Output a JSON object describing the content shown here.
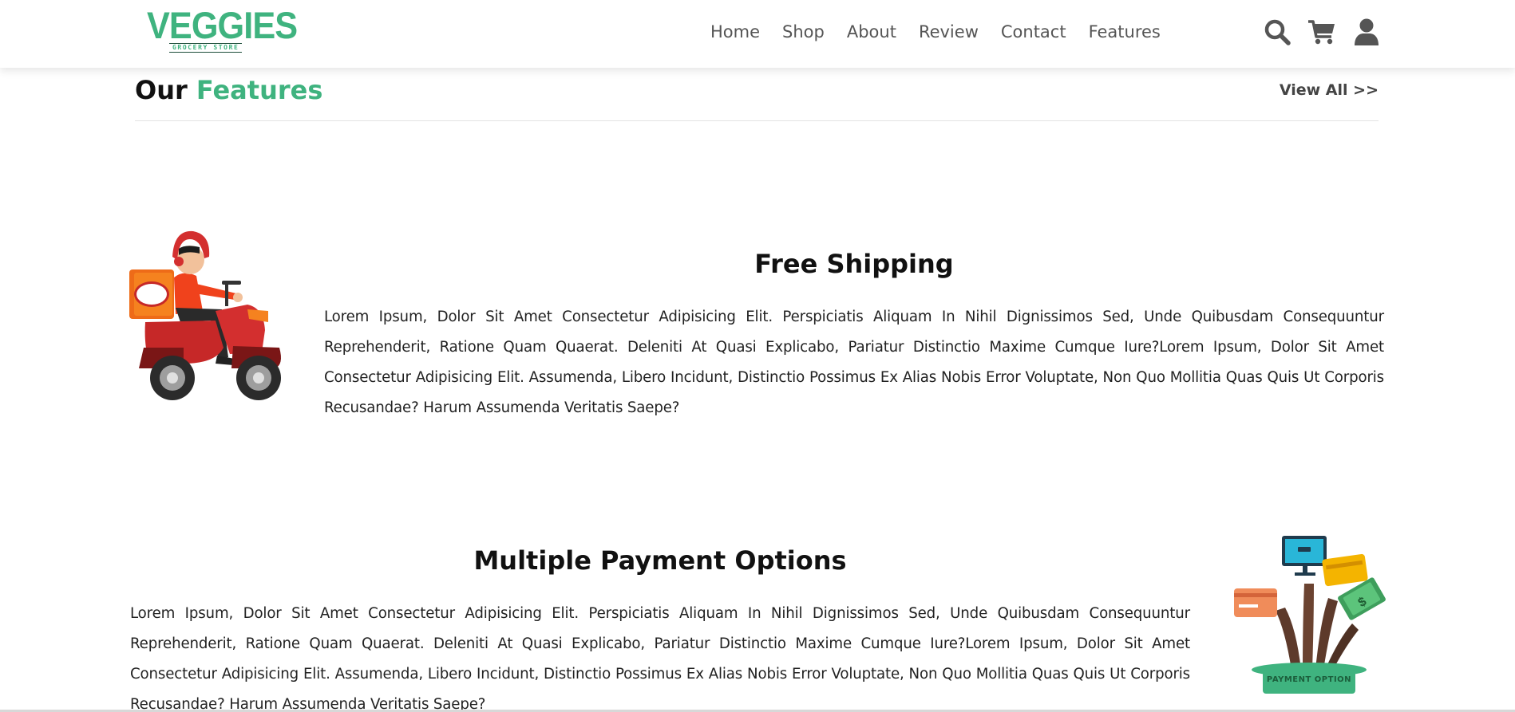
{
  "brand": {
    "name": "VEGGIES",
    "tagline": "GROCERY STORE",
    "accent_color": "#3fb37f"
  },
  "nav": {
    "items": [
      {
        "label": "Home"
      },
      {
        "label": "Shop"
      },
      {
        "label": "About"
      },
      {
        "label": "Review"
      },
      {
        "label": "Contact"
      },
      {
        "label": "Features"
      }
    ]
  },
  "header_icons": [
    "search-icon",
    "cart-icon",
    "user-icon"
  ],
  "section": {
    "title_plain": "Our",
    "title_accent": "Features",
    "view_all": "View All >>"
  },
  "features": [
    {
      "title": "Free Shipping",
      "text": "Lorem Ipsum, Dolor Sit Amet Consectetur Adipisicing Elit. Perspiciatis Aliquam In Nihil Dignissimos Sed, Unde Quibusdam Consequuntur Reprehenderit, Ratione Quam Quaerat. Deleniti At Quasi Explicabo, Pariatur Distinctio Maxime Cumque Iure?Lorem Ipsum, Dolor Sit Amet Consectetur Adipisicing Elit. Assumenda, Libero Incidunt, Distinctio Possimus Ex Alias Nobis Error Voluptate, Non Quo Mollitia Quas Quis Ut Corporis Recusandae? Harum Assumenda Veritatis Saepe?",
      "illustration": "delivery-scooter-illustration"
    },
    {
      "title": "Multiple Payment Options",
      "text": "Lorem Ipsum, Dolor Sit Amet Consectetur Adipisicing Elit. Perspiciatis Aliquam In Nihil Dignissimos Sed, Unde Quibusdam Consequuntur Reprehenderit, Ratione Quam Quaerat. Deleniti At Quasi Explicabo, Pariatur Distinctio Maxime Cumque Iure?Lorem Ipsum, Dolor Sit Amet Consectetur Adipisicing Elit. Assumenda, Libero Incidunt, Distinctio Possimus Ex Alias Nobis Error Voluptate, Non Quo Mollitia Quas Quis Ut Corporis Recusandae? Harum Assumenda Veritatis Saepe?",
      "illustration": "payment-options-illustration",
      "illustration_label": "PAYMENT OPTION"
    }
  ]
}
